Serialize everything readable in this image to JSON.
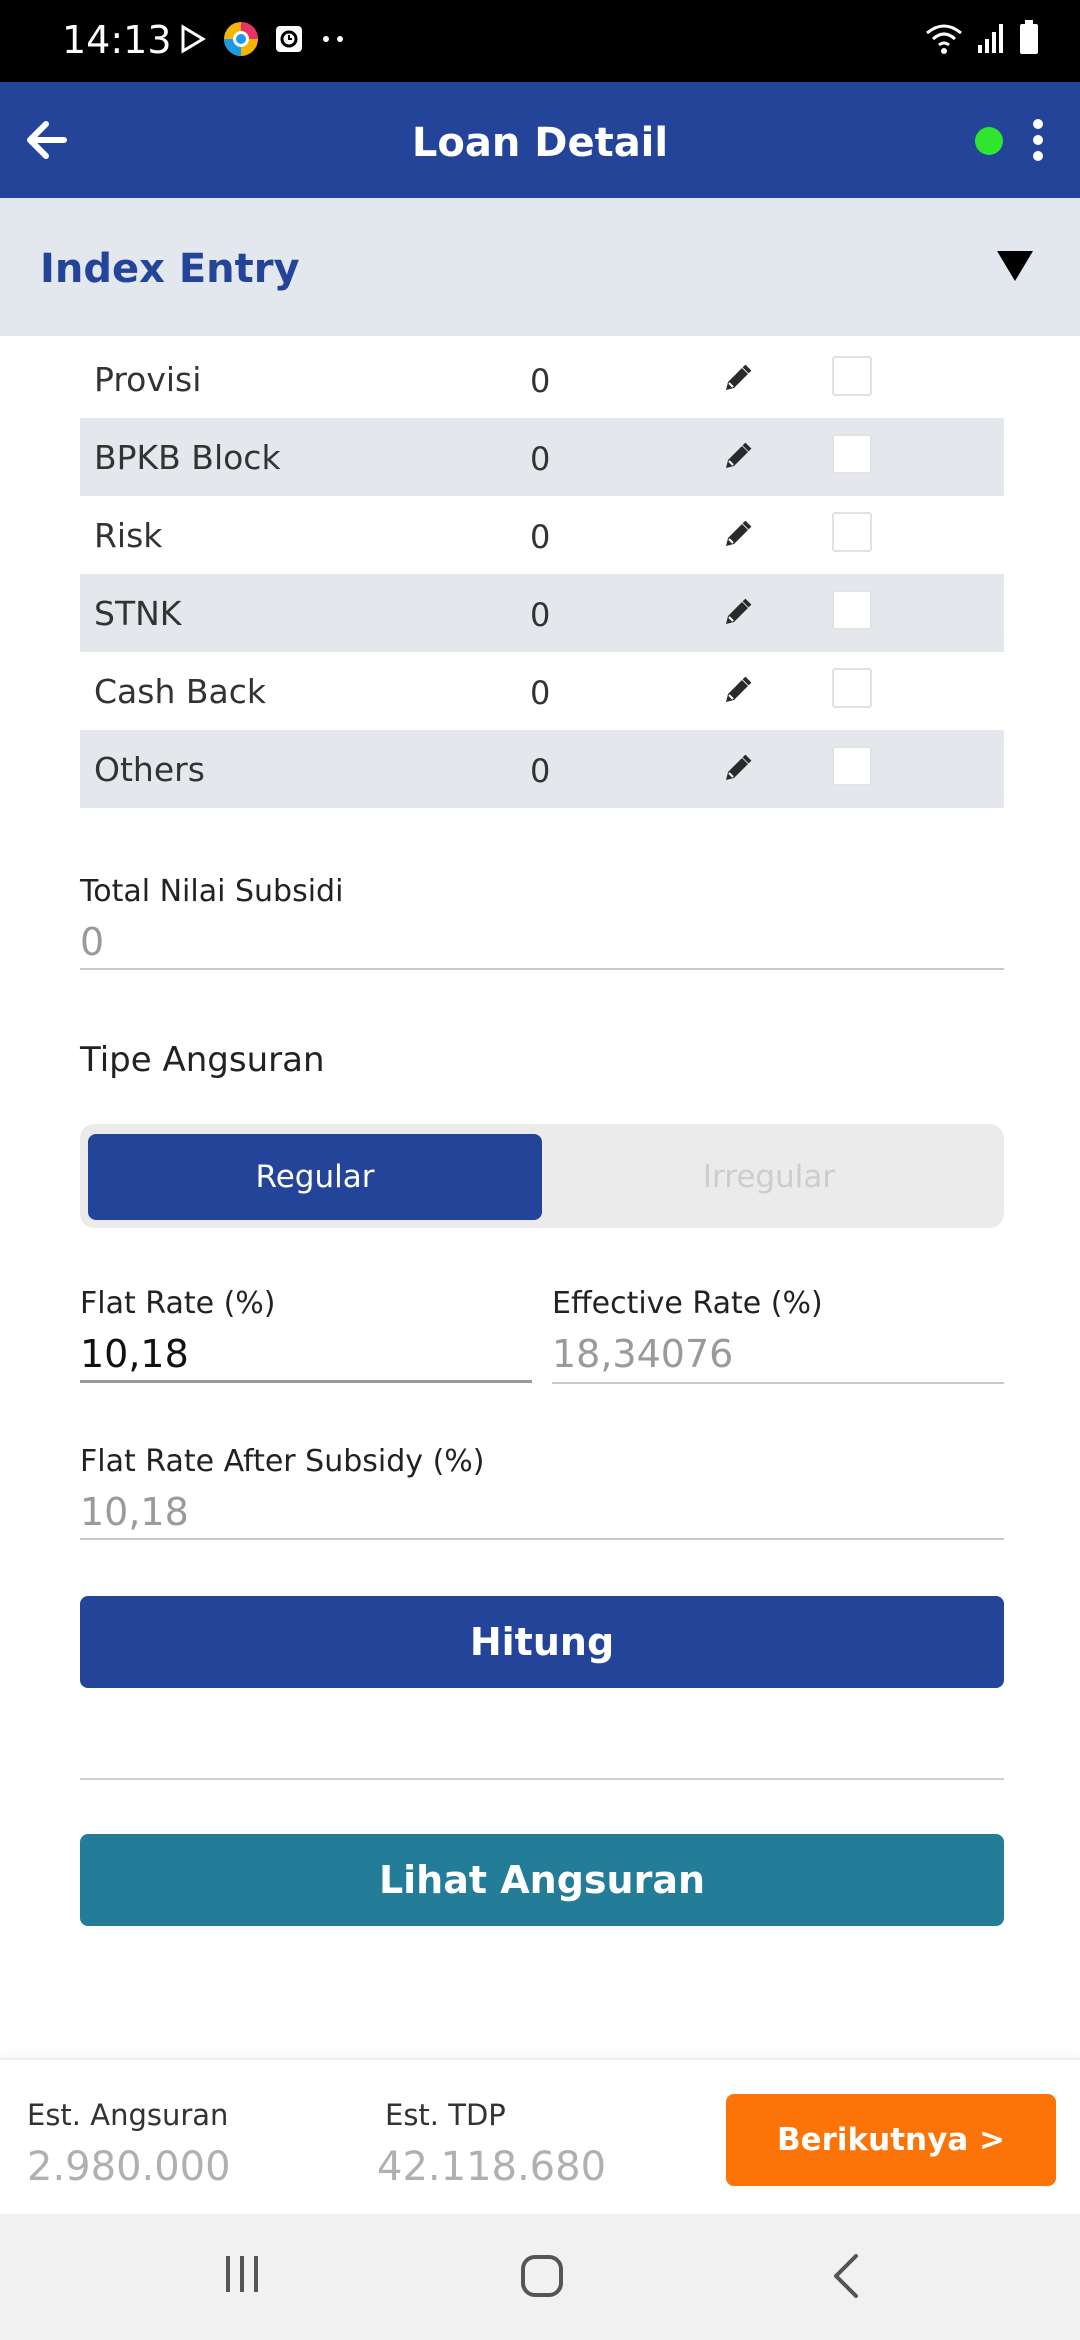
{
  "status_bar": {
    "time": "14:13",
    "icons_left": [
      "play-store-icon",
      "browser-icon",
      "clock-app-icon",
      "more-dots-icon"
    ],
    "icons_right": [
      "wifi-icon",
      "signal-icon",
      "battery-icon"
    ]
  },
  "app_bar": {
    "title": "Loan Detail",
    "status_color": "#2ee62e",
    "back_icon": "arrow-left-icon",
    "menu_icon": "more-vertical-icon"
  },
  "section": {
    "title": "Index Entry",
    "toggle_icon": "triangle-down-icon"
  },
  "subsidy_table": {
    "rows": [
      {
        "label": "Provisi",
        "value": "0",
        "checked": false
      },
      {
        "label": "BPKB Block",
        "value": "0",
        "checked": false
      },
      {
        "label": "Risk",
        "value": "0",
        "checked": false
      },
      {
        "label": "STNK",
        "value": "0",
        "checked": false
      },
      {
        "label": "Cash Back",
        "value": "0",
        "checked": false
      },
      {
        "label": "Others",
        "value": "0",
        "checked": false
      }
    ]
  },
  "total_subsidy": {
    "label": "Total Nilai Subsidi",
    "value": "0"
  },
  "installment_type": {
    "label": "Tipe Angsuran",
    "options": [
      "Regular",
      "Irregular"
    ],
    "selected": "Regular"
  },
  "rates": {
    "flat_label": "Flat Rate (%)",
    "flat_value": "10,18",
    "effective_label": "Effective Rate (%)",
    "effective_value": "18,34076",
    "after_subsidy_label": "Flat Rate After Subsidy (%)",
    "after_subsidy_value": "10,18"
  },
  "buttons": {
    "calculate": "Hitung",
    "view_installments": "Lihat Angsuran",
    "next": "Berikutnya >"
  },
  "summary": {
    "installment_label": "Est. Angsuran",
    "installment_value": "2.980.000",
    "tdp_label": "Est. TDP",
    "tdp_value": "42.118.680"
  },
  "colors": {
    "primary": "#24449a",
    "teal": "#237d98",
    "orange": "#fc7408",
    "header_bg": "#e3e8ee"
  }
}
